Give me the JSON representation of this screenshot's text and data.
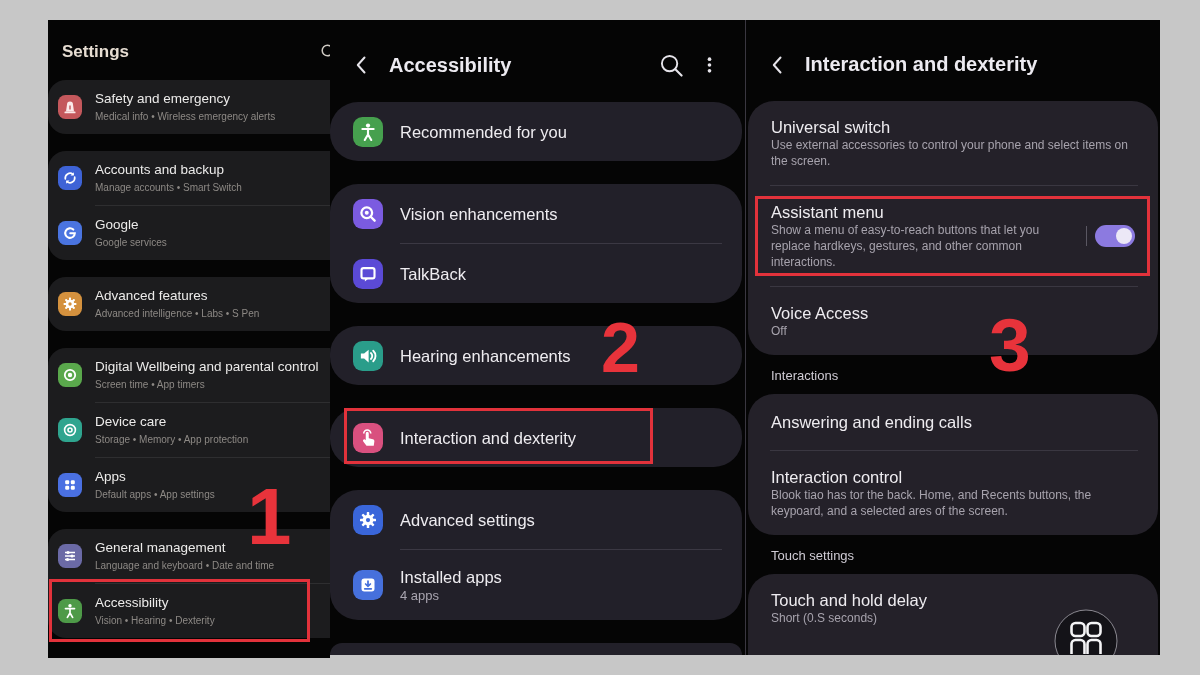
{
  "panels": [
    {
      "kind": "main",
      "title": "Settings",
      "step_label": "1",
      "more_below": false,
      "floating_button": false,
      "groups": [
        {
          "items": [
            {
              "title": "Safety and emergency",
              "subtitle": "Medical info • Wireless emergency alerts",
              "color": "#c4585c",
              "highlighted": false
            }
          ]
        },
        {
          "items": [
            {
              "title": "Accounts and backup",
              "subtitle": "Manage accounts • Smart Switch",
              "color": "#3e63d6",
              "highlighted": false
            },
            {
              "title": "Google",
              "subtitle": "Google services",
              "color": "#4a74e0",
              "highlighted": false
            }
          ]
        },
        {
          "items": [
            {
              "title": "Advanced features",
              "subtitle": "Advanced intelligence • Labs • S Pen",
              "color": "#d4913e",
              "highlighted": false
            }
          ]
        },
        {
          "items": [
            {
              "title": "Digital Wellbeing and parental control",
              "subtitle": "Screen time • App timers",
              "color": "#5aa84c",
              "highlighted": false
            },
            {
              "title": "Device care",
              "subtitle": "Storage • Memory • App protection",
              "color": "#2fa58f",
              "highlighted": false
            },
            {
              "title": "Apps",
              "subtitle": "Default apps • App settings",
              "color": "#4a70e2",
              "highlighted": false
            }
          ]
        },
        {
          "items": [
            {
              "title": "General management",
              "subtitle": "Language and keyboard • Date and time",
              "color": "#6b6aa6",
              "highlighted": false
            },
            {
              "title": "Accessibility",
              "subtitle": "Vision • Hearing • Dexterity",
              "color": "#4e9a48",
              "highlighted": true
            }
          ]
        }
      ]
    },
    {
      "kind": "sub",
      "title": "Accessibility",
      "step_label": "2",
      "more_below": true,
      "floating_button": false,
      "groups": [
        {
          "items": [
            {
              "title": "Recommended for you",
              "color": "#46a04e",
              "highlighted": false
            }
          ]
        },
        {
          "items": [
            {
              "title": "Vision enhancements",
              "color": "#7b5be0",
              "highlighted": false
            },
            {
              "title": "TalkBack",
              "color": "#5b4ad6",
              "highlighted": false
            }
          ]
        },
        {
          "items": [
            {
              "title": "Hearing enhancements",
              "color": "#2a9d8a",
              "highlighted": false
            }
          ]
        },
        {
          "items": [
            {
              "title": "Interaction and dexterity",
              "color": "#d9507f",
              "highlighted": true
            }
          ]
        },
        {
          "items": [
            {
              "title": "Advanced settings",
              "color": "#3a66da",
              "highlighted": false
            },
            {
              "title": "Installed apps",
              "subtitle": "4 apps",
              "color": "#4670dc",
              "highlighted": false
            }
          ]
        }
      ]
    },
    {
      "kind": "detail",
      "title": "Interaction and dexterity",
      "step_label": "3",
      "more_below": false,
      "floating_button": true,
      "groups": [
        {
          "items": [
            {
              "kind": "plain",
              "title": "Universal switch",
              "subtitle": "Use external accessories to control your phone and select items on the screen.",
              "highlighted": false
            },
            {
              "kind": "switch",
              "title": "Assistant menu",
              "subtitle": "Show a menu of easy-to-reach buttons that let you replace hardkeys, gestures, and other common interactions.",
              "on": true,
              "highlighted": true
            },
            {
              "kind": "plain",
              "title": "Voice Access",
              "subtitle": "Off",
              "highlighted": false
            }
          ]
        },
        {
          "heading": "Interactions",
          "items": [
            {
              "kind": "plain",
              "title": "Answering and ending calls",
              "highlighted": false
            },
            {
              "kind": "plain",
              "title": "Interaction control",
              "subtitle": "Blook tiao has tor the back. Home, and Recents buttons, the keypoard, and a selected ares of the screen.",
              "highlighted": false
            }
          ]
        },
        {
          "heading": "Touch settings",
          "items": [
            {
              "kind": "plain",
              "title": "Touch and hold delay",
              "subtitle": "Short (0.S seconds)",
              "highlighted": false
            }
          ]
        }
      ]
    }
  ]
}
